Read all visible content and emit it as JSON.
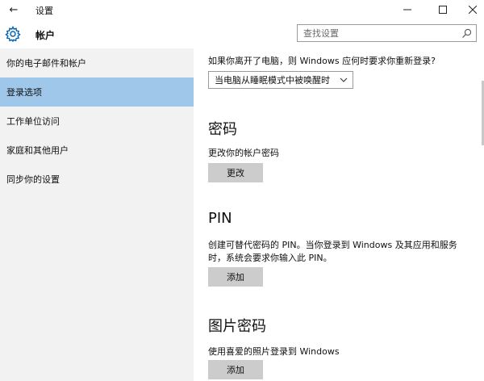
{
  "window": {
    "title": "设置",
    "back_glyph": "←",
    "minimize_glyph": "—",
    "close_glyph": "✕"
  },
  "header": {
    "title": "帐户",
    "search": {
      "placeholder": "查找设置"
    }
  },
  "sidebar": {
    "items": [
      {
        "label": "你的电子邮件和帐户",
        "active": false
      },
      {
        "label": "登录选项",
        "active": true
      },
      {
        "label": "工作单位访问",
        "active": false
      },
      {
        "label": "家庭和其他用户",
        "active": false
      },
      {
        "label": "同步你的设置",
        "active": false
      }
    ]
  },
  "main": {
    "wake_question": "如果你离开了电脑，则 Windows 应何时要求你重新登录?",
    "wake_dropdown": {
      "selected": "当电脑从睡眠模式中被唤醒时"
    },
    "password": {
      "title": "密码",
      "description": "更改你的帐户密码",
      "button_label": "更改"
    },
    "pin": {
      "title": "PIN",
      "description": "创建可替代密码的 PIN。当你登录到 Windows 及其应用和服务时，系统会要求你输入此 PIN。",
      "button_label": "添加"
    },
    "picture_password": {
      "title": "图片密码",
      "description": "使用喜爱的照片登录到 Windows",
      "button_label": "添加"
    }
  },
  "colors": {
    "sidebar_bg": "#f2f2f2",
    "active_item_bg": "#9ec7ea",
    "button_bg": "#cccccc",
    "accent_icon": "#0063b1"
  }
}
